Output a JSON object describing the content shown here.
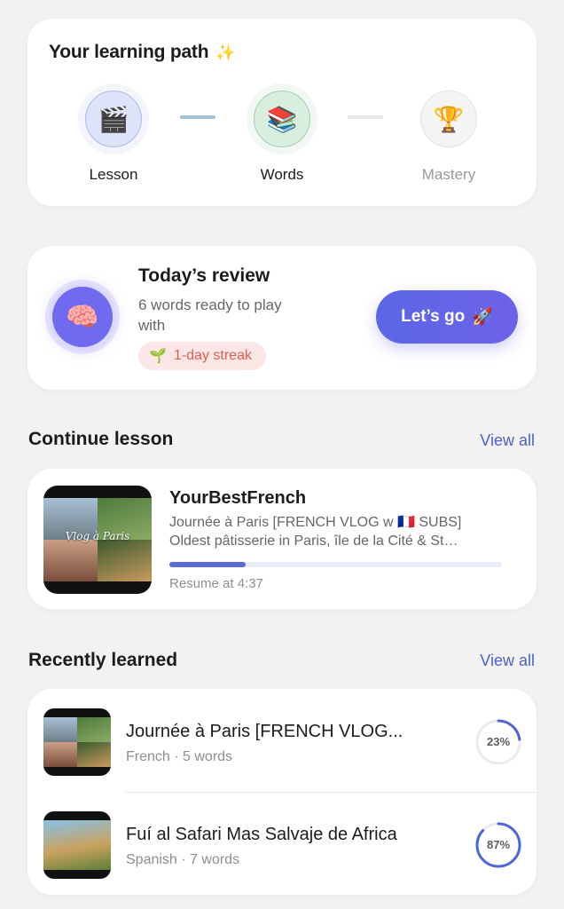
{
  "learning_path": {
    "title": "Your learning path",
    "title_icon": "sparkles-icon",
    "steps": [
      {
        "label": "Lesson",
        "icon": "clapperboard-icon",
        "state": "done",
        "glyph": "🎬"
      },
      {
        "label": "Words",
        "icon": "books-icon",
        "state": "done",
        "glyph": "📚"
      },
      {
        "label": "Mastery",
        "icon": "trophy-icon",
        "state": "locked",
        "glyph": "🏆"
      }
    ]
  },
  "review": {
    "title": "Today’s review",
    "subtitle": "6 words ready to play with",
    "streak": "1-day streak",
    "streak_icon": "seedling-icon",
    "button_label": "Let’s go",
    "button_icon": "rocket-icon",
    "brain_icon": "brain-icon"
  },
  "continue_lesson": {
    "section_title": "Continue lesson",
    "view_all": "View all",
    "channel": "YourBestFrench",
    "line1": "Journée à Paris [FRENCH VLOG w 🇫🇷 SUBS]",
    "line2": "Oldest pâtisserie in Paris, île de la Cité & St…",
    "thumbnail_caption": "Vlog à Paris",
    "progress": 0.23,
    "resume_text": "Resume at 4:37"
  },
  "recently_learned": {
    "section_title": "Recently learned",
    "view_all": "View all",
    "items": [
      {
        "title": "Journée à Paris [FRENCH VLOG...",
        "meta": "French · 5 words",
        "percent_label": "23%",
        "percent": 0.23
      },
      {
        "title": "Fuí al Safari Mas Salvaje de Africa",
        "meta": "Spanish · 7 words",
        "percent_label": "87%",
        "percent": 0.87
      }
    ]
  },
  "colors": {
    "accent": "#5a66e6",
    "link": "#4a63d0",
    "ring": "#4f67d6",
    "streak_bg": "#fbe7e5",
    "streak_text": "#e05d54"
  }
}
